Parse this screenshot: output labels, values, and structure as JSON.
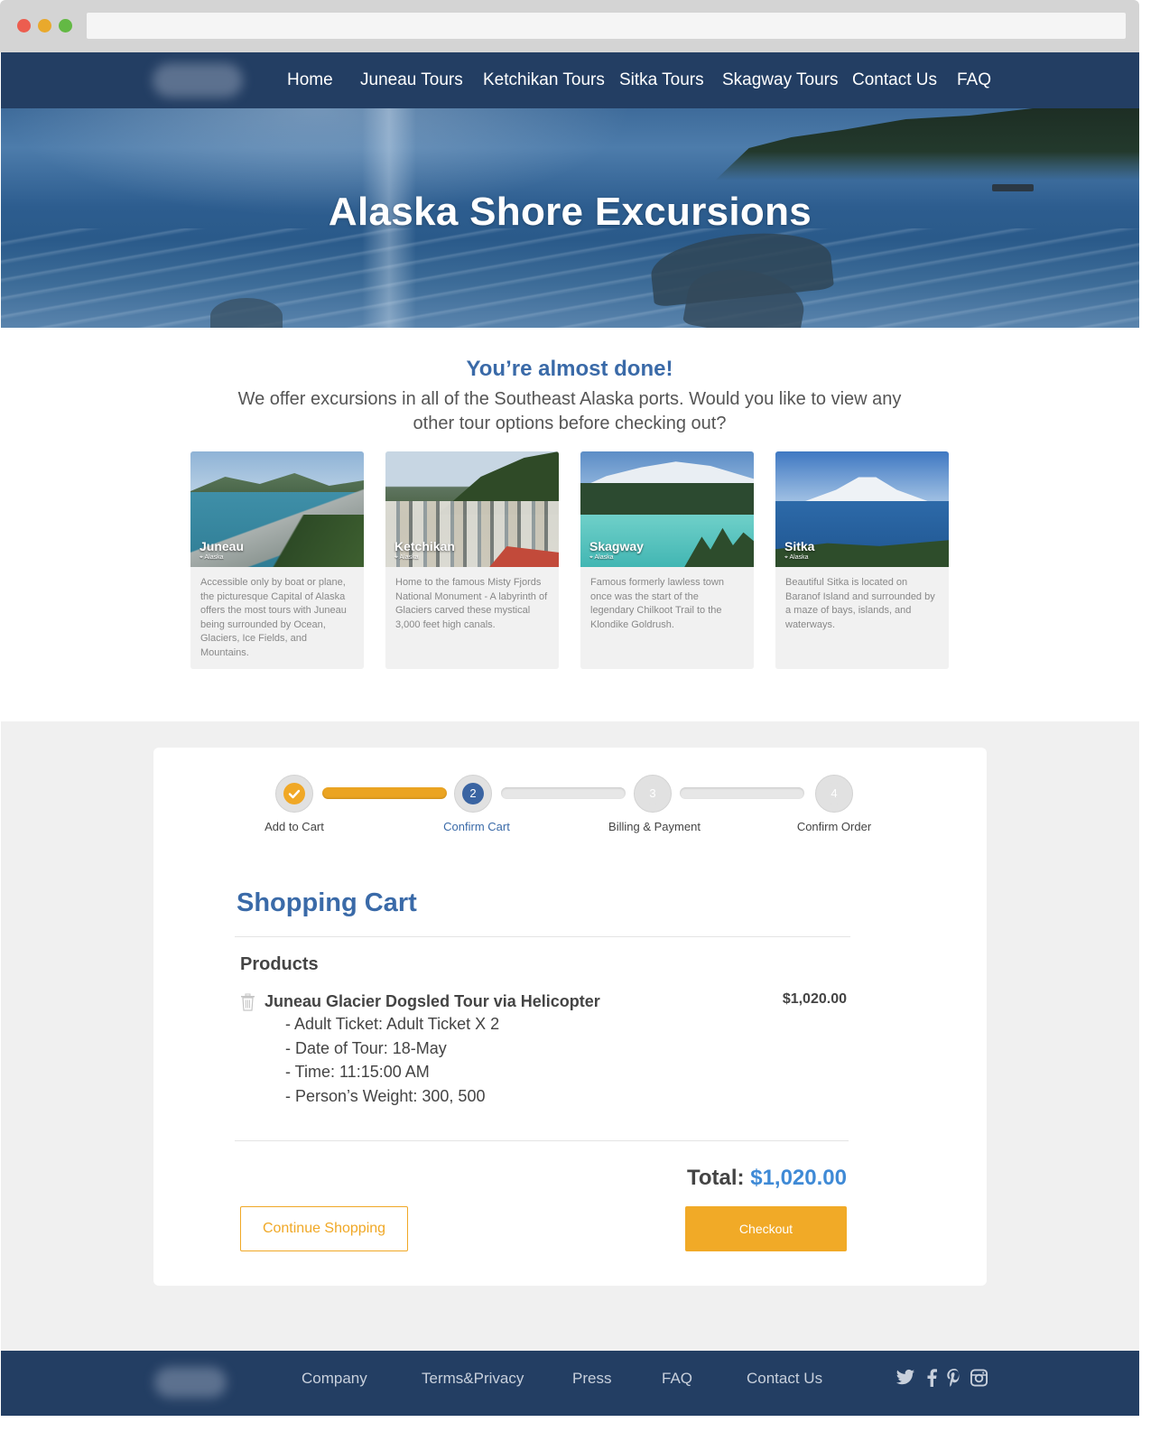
{
  "nav": {
    "links": [
      "Home",
      "Juneau Tours",
      "Ketchikan Tours",
      "Sitka Tours",
      "Skagway Tours",
      "Contact Us",
      "FAQ"
    ]
  },
  "hero": {
    "title": "Alaska Shore Excursions"
  },
  "almost": {
    "heading": "You’re almost done!",
    "text": "We offer excursions in all of the Southeast Alaska ports. Would you like to view any other tour options before checking out?"
  },
  "cards": [
    {
      "name": "Juneau",
      "location": "Alaska",
      "desc": "Accessible only by boat or plane, the picturesque Capital of Alaska offers the most tours with Juneau being surrounded by Ocean, Glaciers, Ice Fields, and Mountains."
    },
    {
      "name": "Ketchikan",
      "location": "Alaska",
      "desc": "Home to the famous Misty Fjords National Monument -   A labyrinth of Glaciers carved these mystical 3,000 feet high canals."
    },
    {
      "name": "Skagway",
      "location": "Alaska",
      "desc": "Famous formerly lawless town once was the start of the legendary Chilkoot Trail to the Klondike Goldrush."
    },
    {
      "name": "Sitka",
      "location": "Alaska",
      "desc": "Beautiful Sitka is located on Baranof Island and surrounded by a maze of bays, islands, and waterways."
    }
  ],
  "progress": {
    "steps": [
      {
        "label": "Add to Cart",
        "number": "",
        "state": "done"
      },
      {
        "label": "Confirm Cart",
        "number": "2",
        "state": "current"
      },
      {
        "label": "Billing & Payment",
        "number": "3",
        "state": "todo"
      },
      {
        "label": "Confirm Order",
        "number": "4",
        "state": "todo"
      }
    ],
    "colors": {
      "done": "#f0a826",
      "current": "#3a64a2",
      "todo": "#e1e1e1"
    }
  },
  "cart": {
    "title": "Shopping Cart",
    "products_heading": "Products",
    "item": {
      "name": "Juneau Glacier Dogsled Tour via Helicopter",
      "price": "$1,020.00",
      "options": [
        "- Adult Ticket: Adult Ticket X 2",
        "- Date of Tour: 18-May",
        "- Time: 11:15:00 AM",
        "- Person’s Weight: 300, 500"
      ]
    },
    "total_label": "Total:",
    "total_value": "$1,020.00",
    "continue_label": "Continue Shopping",
    "checkout_label": "Checkout"
  },
  "footer": {
    "links": [
      "Company",
      "Terms&Privacy",
      "Press",
      "FAQ",
      "Contact Us"
    ],
    "social_icons": [
      "twitter-icon",
      "facebook-icon",
      "pinterest-icon",
      "instagram-icon"
    ]
  },
  "colors": {
    "nav_bg": "#233e63",
    "accent_blue": "#3a6aa8",
    "accent_orange": "#f0a826",
    "total_blue": "#3f8ad6"
  }
}
